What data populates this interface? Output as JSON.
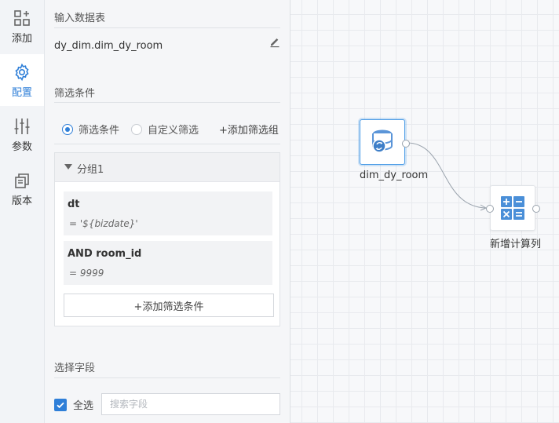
{
  "rail": {
    "items": [
      {
        "label": "添加",
        "icon": "add-grid-icon"
      },
      {
        "label": "配置",
        "icon": "gear-icon"
      },
      {
        "label": "参数",
        "icon": "sliders-icon"
      },
      {
        "label": "版本",
        "icon": "copy-icon"
      }
    ],
    "active_color": "#2f7fd8"
  },
  "panel": {
    "input_table": {
      "title": "输入数据表",
      "value": "dy_dim.dim_dy_room"
    },
    "filter": {
      "title": "筛选条件",
      "radio_filter": "筛选条件",
      "radio_custom": "自定义筛选",
      "selected_mode": "筛选条件",
      "add_group": "+添加筛选组",
      "group": {
        "title": "分组1",
        "conditions": [
          {
            "field": "dt",
            "value": "= '${bizdate}'"
          },
          {
            "field": "AND room_id",
            "value": "= 9999"
          }
        ],
        "add_condition": "+添加筛选条件"
      }
    },
    "fields": {
      "title": "选择字段",
      "select_all": "全选",
      "search_placeholder": "搜索字段",
      "search_value": ""
    }
  },
  "canvas": {
    "nodes": [
      {
        "label": "dim_dy_room",
        "icon": "database-sync-icon",
        "selected": true
      },
      {
        "label": "新增计算列",
        "icon": "calculator-icon",
        "selected": false
      }
    ]
  }
}
